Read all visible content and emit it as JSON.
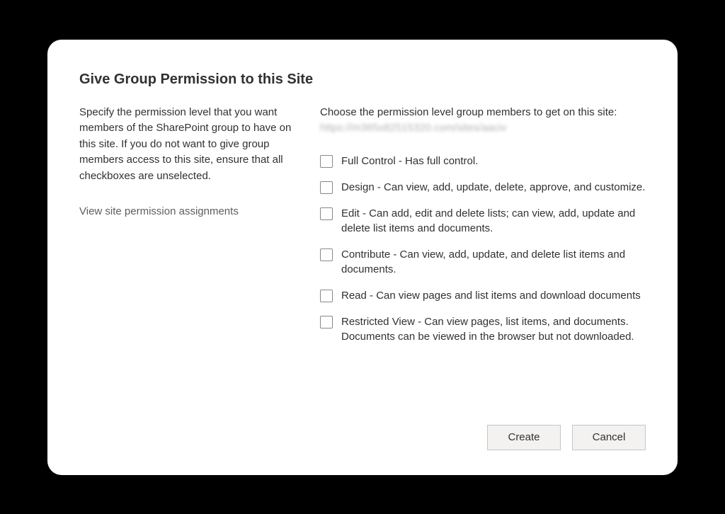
{
  "dialog": {
    "title": "Give Group Permission to this Site",
    "description": "Specify the permission level that you want members of the SharePoint group to have on this site. If you do not want to give group members access to this site, ensure that all checkboxes are unselected.",
    "link_text": "View site permission assignments",
    "prompt_text": "Choose the permission level group members to get on this site: ",
    "site_url": "https://m365x82515320.com/sites/aaciv",
    "permissions": [
      {
        "label": "Full Control - Has full control."
      },
      {
        "label": "Design - Can view, add, update, delete, approve, and customize."
      },
      {
        "label": "Edit - Can add, edit and delete lists; can view, add, update and delete list items and documents."
      },
      {
        "label": "Contribute - Can view, add, update, and delete list items and documents."
      },
      {
        "label": "Read - Can view pages and list items and download documents"
      },
      {
        "label": "Restricted View - Can view pages, list items, and documents. Documents can be viewed in the browser but not downloaded."
      }
    ],
    "buttons": {
      "create": "Create",
      "cancel": "Cancel"
    }
  }
}
